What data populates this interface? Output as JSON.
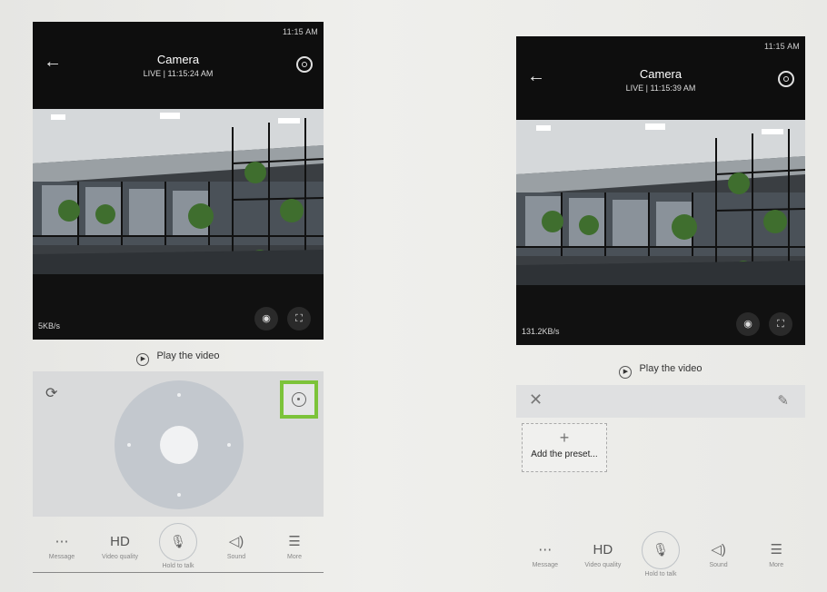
{
  "left_screen": {
    "status_time": "11:15 AM",
    "title": "Camera",
    "subtitle": "LIVE | 11:15:24 AM",
    "rate": "5KB/s",
    "play_label": "Play the video",
    "bottom": [
      {
        "icon": "message-icon",
        "glyph": "⋯",
        "label": "Message"
      },
      {
        "icon": "hd-icon",
        "glyph": "HD",
        "label": "Video quality"
      },
      {
        "icon": "mic-icon",
        "glyph": "🎙",
        "label": "Hold to talk"
      },
      {
        "icon": "sound-icon",
        "glyph": "◁)",
        "label": "Sound"
      },
      {
        "icon": "menu-icon",
        "glyph": "☰",
        "label": "More"
      }
    ]
  },
  "right_screen": {
    "status_time": "11:15 AM",
    "title": "Camera",
    "subtitle": "LIVE | 11:15:39 AM",
    "rate": "131.2KB/s",
    "play_label": "Play the video",
    "add_preset_label": "Add the preset...",
    "bottom": [
      {
        "icon": "message-icon",
        "glyph": "⋯",
        "label": "Message"
      },
      {
        "icon": "hd-icon",
        "glyph": "HD",
        "label": "Video quality"
      },
      {
        "icon": "mic-icon",
        "glyph": "🎙",
        "label": "Hold to talk"
      },
      {
        "icon": "sound-icon",
        "glyph": "◁)",
        "label": "Sound"
      },
      {
        "icon": "menu-icon",
        "glyph": "☰",
        "label": "More"
      }
    ]
  },
  "colors": {
    "highlight": "#7cc33a",
    "topbar": "#0e0e0e",
    "control_bg": "#d9dadb"
  }
}
